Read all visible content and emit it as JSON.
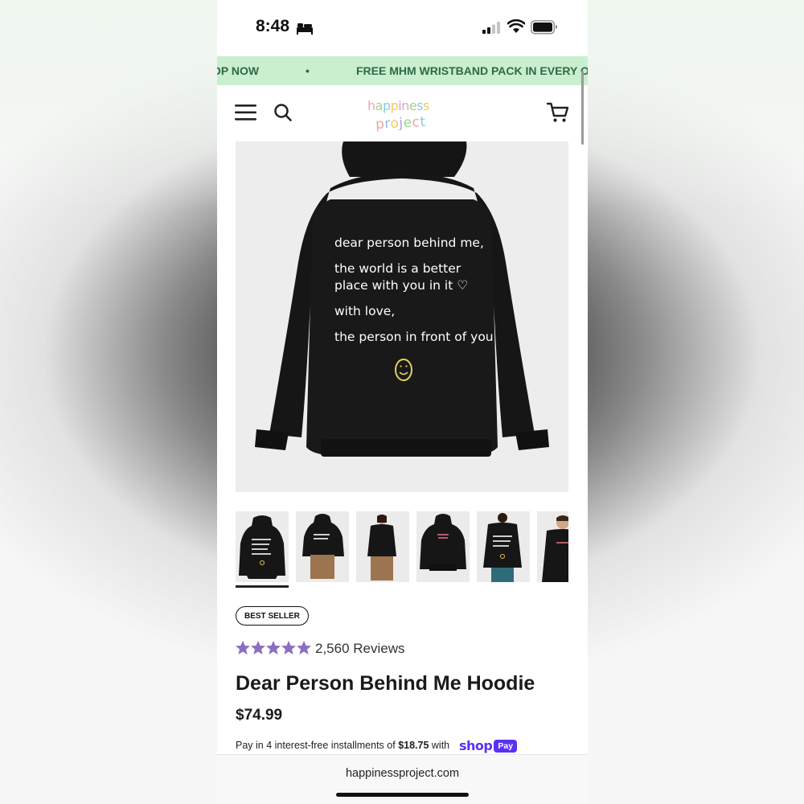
{
  "status_bar": {
    "time": "8:48"
  },
  "announcement": {
    "left_text": "OP NOW",
    "separator": "•",
    "right_text": "FREE MHM WRISTBAND PACK IN EVERY ORD"
  },
  "header": {
    "menu_icon": "hamburger-icon",
    "search_icon": "search-icon",
    "cart_icon": "cart-icon",
    "logo_line1": "happiness",
    "logo_line2": "project"
  },
  "product_image": {
    "back_text": [
      "dear person behind me,",
      "the world is a better\nplace with you in it ♡",
      "with love,",
      "the person in front of you"
    ]
  },
  "gallery": {
    "thumbnail_count": 6,
    "active_index": 0
  },
  "product": {
    "badge": "BEST SELLER",
    "rating": 5,
    "reviews_label": "2,560 Reviews",
    "title": "Dear Person Behind Me Hoodie",
    "price": "$74.99",
    "installments_prefix": "Pay in 4 interest-free installments of",
    "installment_amount": "$18.75",
    "installments_suffix": "with",
    "shop_pay_label": "shop",
    "shop_pay_pill": "Pay"
  },
  "browser": {
    "url": "happinessproject.com"
  },
  "colors": {
    "announcement_bg": "#c9efd0",
    "announcement_text": "#2f6a45",
    "star": "#8a6fc0",
    "shop_pay": "#5a31f4"
  }
}
